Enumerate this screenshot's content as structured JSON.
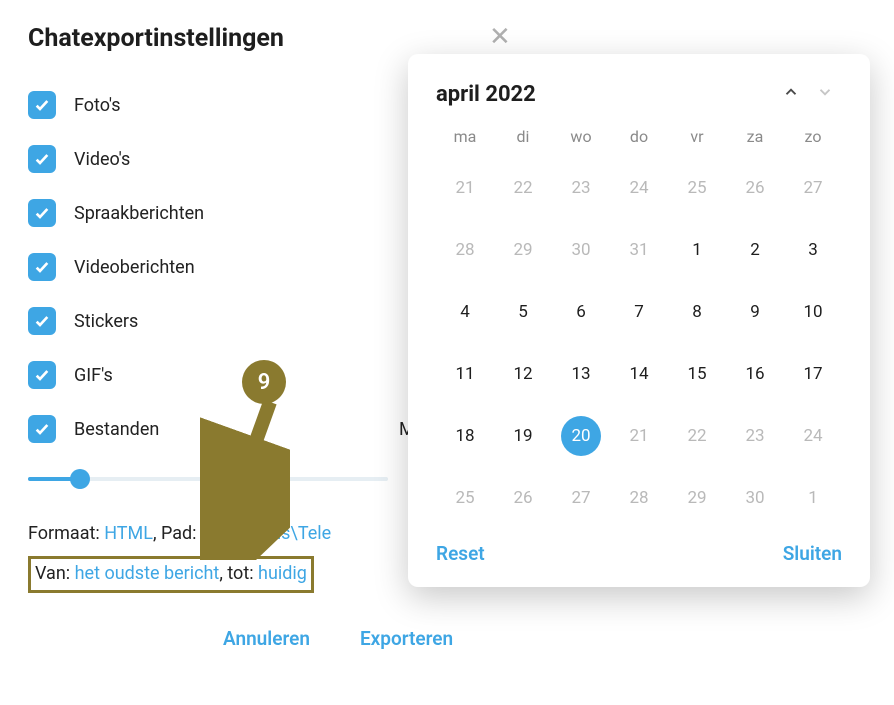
{
  "title": "Chatexportinstellingen",
  "checks": [
    {
      "label": "Foto's",
      "checked": true
    },
    {
      "label": "Video's",
      "checked": true
    },
    {
      "label": "Spraakberichten",
      "checked": true
    },
    {
      "label": "Videoberichten",
      "checked": true
    },
    {
      "label": "Stickers",
      "checked": true
    },
    {
      "label": "GIF's",
      "checked": true
    },
    {
      "label": "Bestanden",
      "checked": true,
      "extra": "Maximale gr"
    }
  ],
  "meta": {
    "format_label": "Formaat: ",
    "format_value": "HTML",
    "path_label": ", Pad: ",
    "path_value": "Downloads\\Tele",
    "from_label": "Van: ",
    "from_value": "het oudste bericht",
    "to_label": ", tot: ",
    "to_value": "huidig"
  },
  "actions": {
    "cancel": "Annuleren",
    "export": "Exporteren"
  },
  "annotation": {
    "badge": "9"
  },
  "calendar": {
    "title": "april 2022",
    "dow": [
      "ma",
      "di",
      "wo",
      "do",
      "vr",
      "za",
      "zo"
    ],
    "weeks": [
      [
        {
          "n": 21,
          "o": true
        },
        {
          "n": 22,
          "o": true
        },
        {
          "n": 23,
          "o": true
        },
        {
          "n": 24,
          "o": true
        },
        {
          "n": 25,
          "o": true
        },
        {
          "n": 26,
          "o": true
        },
        {
          "n": 27,
          "o": true
        }
      ],
      [
        {
          "n": 28,
          "o": true
        },
        {
          "n": 29,
          "o": true
        },
        {
          "n": 30,
          "o": true
        },
        {
          "n": 31,
          "o": true
        },
        {
          "n": 1
        },
        {
          "n": 2
        },
        {
          "n": 3
        }
      ],
      [
        {
          "n": 4
        },
        {
          "n": 5
        },
        {
          "n": 6
        },
        {
          "n": 7
        },
        {
          "n": 8
        },
        {
          "n": 9
        },
        {
          "n": 10
        }
      ],
      [
        {
          "n": 11
        },
        {
          "n": 12
        },
        {
          "n": 13
        },
        {
          "n": 14
        },
        {
          "n": 15
        },
        {
          "n": 16
        },
        {
          "n": 17
        }
      ],
      [
        {
          "n": 18
        },
        {
          "n": 19
        },
        {
          "n": 20,
          "sel": true
        },
        {
          "n": 21,
          "o": true
        },
        {
          "n": 22,
          "o": true
        },
        {
          "n": 23,
          "o": true
        },
        {
          "n": 24,
          "o": true
        }
      ],
      [
        {
          "n": 25,
          "o": true
        },
        {
          "n": 26,
          "o": true
        },
        {
          "n": 27,
          "o": true
        },
        {
          "n": 28,
          "o": true
        },
        {
          "n": 29,
          "o": true
        },
        {
          "n": 30,
          "o": true
        },
        {
          "n": 1,
          "o": true
        }
      ]
    ],
    "reset": "Reset",
    "close": "Sluiten"
  }
}
